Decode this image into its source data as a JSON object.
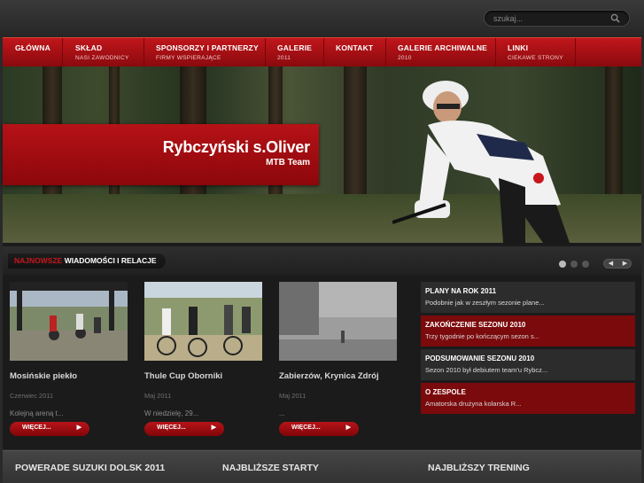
{
  "search": {
    "placeholder": "szukaj..."
  },
  "nav": [
    {
      "label": "GŁÓWNA",
      "sub": ""
    },
    {
      "label": "SKŁAD",
      "sub": "NASI ZAWODNICY"
    },
    {
      "label": "SPONSORZY I PARTNERZY",
      "sub": "FIRMY WSPIERAJĄCE"
    },
    {
      "label": "GALERIE",
      "sub": "2011"
    },
    {
      "label": "KONTAKT",
      "sub": ""
    },
    {
      "label": "GALERIE ARCHIWALNE",
      "sub": "2010"
    },
    {
      "label": "LINKI",
      "sub": "CIEKAWE STRONY"
    }
  ],
  "hero": {
    "title": "Rybczyński s.Oliver",
    "subtitle": "MTB Team"
  },
  "news": {
    "heading_highlight": "NAJNOWSZE",
    "heading_rest": "WIADOMOŚCI I RELACJE",
    "cards": [
      {
        "title": "Mosińskie piekło",
        "date": "Czerwiec 2011",
        "excerpt": "Kolejną areną t...",
        "more": "WIĘCEJ..."
      },
      {
        "title": "Thule Cup Oborniki",
        "date": "Maj 2011",
        "excerpt": "W niedzielę, 29...",
        "more": "WIĘCEJ..."
      },
      {
        "title": "Zabierzów, Krynica Zdrój",
        "date": "Maj 2011",
        "excerpt": "...",
        "more": "WIĘCEJ..."
      }
    ],
    "sidebar": [
      {
        "title": "PLANY NA ROK 2011",
        "text": "Podobnie jak w zeszłym sezonie plane..."
      },
      {
        "title": "ZAKOŃCZENIE SEZONU 2010",
        "text": "Trzy tygodnie po kończącym sezon s..."
      },
      {
        "title": "PODSUMOWANIE SEZONU 2010",
        "text": "Sezon 2010 był debiutem team'u Rybcz..."
      },
      {
        "title": "O ZESPOLE",
        "text": "Amatorska drużyna kolarska R..."
      }
    ]
  },
  "bottom": {
    "col1": "POWERADE SUZUKI DOLSK 2011",
    "col2": "NAJBLIŻSZE STARTY",
    "col3": "NAJBLIŻSZY TRENING"
  },
  "icons": {
    "search": "search-icon",
    "prev": "chevron-left-icon",
    "next": "chevron-right-icon"
  },
  "colors": {
    "accent": "#b51217",
    "dark": "#1b1b1b"
  }
}
